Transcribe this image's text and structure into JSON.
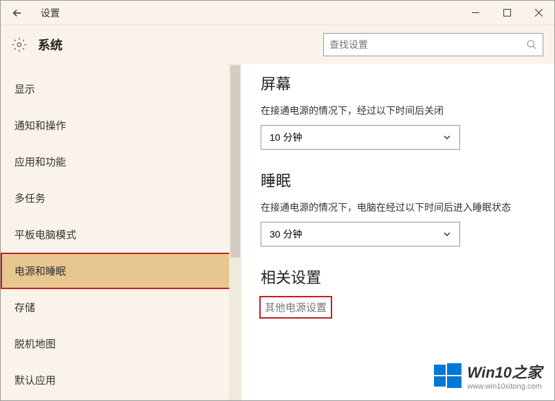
{
  "titlebar": {
    "title": "设置"
  },
  "header": {
    "title": "系统",
    "search_placeholder": "查找设置"
  },
  "sidebar": {
    "items": [
      {
        "label": "显示"
      },
      {
        "label": "通知和操作"
      },
      {
        "label": "应用和功能"
      },
      {
        "label": "多任务"
      },
      {
        "label": "平板电脑模式"
      },
      {
        "label": "电源和睡眠"
      },
      {
        "label": "存储"
      },
      {
        "label": "脱机地图"
      },
      {
        "label": "默认应用"
      }
    ],
    "selected_index": 5
  },
  "main": {
    "screen": {
      "heading": "屏幕",
      "label": "在接通电源的情况下，经过以下时间后关闭",
      "value": "10 分钟"
    },
    "sleep": {
      "heading": "睡眠",
      "label": "在接通电源的情况下，电脑在经过以下时间后进入睡眠状态",
      "value": "30 分钟"
    },
    "related": {
      "heading": "相关设置",
      "link": "其他电源设置"
    }
  },
  "watermark": {
    "main": "Win10之家",
    "sub": "www.win10xitong.com"
  }
}
